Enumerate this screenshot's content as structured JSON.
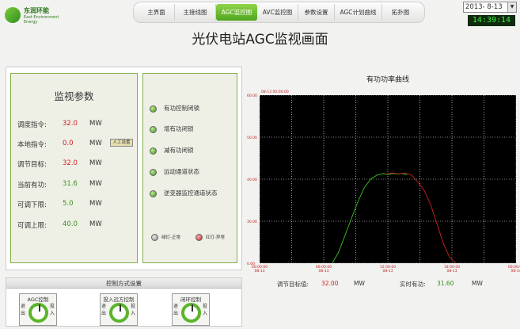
{
  "logo": {
    "name_cn": "东润环能",
    "name_en_1": "East Environment",
    "name_en_2": "Energy"
  },
  "nav": {
    "tabs": [
      {
        "label": "主界面",
        "active": false
      },
      {
        "label": "主接线图",
        "active": false
      },
      {
        "label": "AGC监控图",
        "active": true
      },
      {
        "label": "AVC监控图",
        "active": false
      },
      {
        "label": "参数设置",
        "active": false
      },
      {
        "label": "AGC计划曲线",
        "active": false
      },
      {
        "label": "拓扑图",
        "active": false
      }
    ]
  },
  "date": {
    "value": "2013- 8-13"
  },
  "clock": {
    "value": "14:39:14"
  },
  "page_title": "光伏电站AGC监视画面",
  "params": {
    "title": "监视参数",
    "rows": [
      {
        "label": "调度指令:",
        "value": "32.0",
        "unit": "MW"
      },
      {
        "label": "本地指令:",
        "value": "0.0",
        "unit": "MW",
        "button": "人工设置"
      },
      {
        "label": "调节目标:",
        "value": "32.0",
        "unit": "MW"
      },
      {
        "label": "当前有功:",
        "value": "31.6",
        "unit": "MW"
      },
      {
        "label": "可调下限:",
        "value": "5.0",
        "unit": "MW"
      },
      {
        "label": "可调上限:",
        "value": "40.0",
        "unit": "MW"
      }
    ]
  },
  "status": {
    "items": [
      {
        "label": "有功控制闭锁",
        "state": "green"
      },
      {
        "label": "增有功闭锁",
        "state": "green"
      },
      {
        "label": "减有功闭锁",
        "state": "green"
      },
      {
        "label": "远动通道状态",
        "state": "green"
      },
      {
        "label": "逆变器监控通道状态",
        "state": "green"
      }
    ],
    "legend": [
      {
        "label": "绿灯-正常",
        "state": "gray"
      },
      {
        "label": "红灯-异常",
        "state": "red"
      }
    ]
  },
  "control": {
    "title": "控制方式设置",
    "items": [
      {
        "label": "AGC控制",
        "off": "退出",
        "on": "投入"
      },
      {
        "label": "投入远方控制",
        "off": "退出",
        "on": "投入"
      },
      {
        "label": "闭环控制",
        "off": "退出",
        "on": "投入"
      }
    ]
  },
  "chart_data": {
    "type": "line",
    "title": "有功功率曲线",
    "top_time": "08-13 00:00:00",
    "y_tick_labels": [
      "60.00",
      "50.00",
      "40.00",
      "30.00",
      "0.00"
    ],
    "x_tick_labels": [
      "00:00:00\n08-13",
      "06:00:00\n08-13",
      "12:00:00\n08-13",
      "18:00:00\n08-13",
      "00:00:00\n08-14"
    ],
    "ylim": [
      0,
      60
    ],
    "x_hours_range": [
      0,
      24
    ],
    "grid": true,
    "series": [
      {
        "color": "#38c020",
        "points": [
          [
            6.8,
            0
          ],
          [
            7.4,
            4
          ],
          [
            8.0,
            10
          ],
          [
            8.6,
            16
          ],
          [
            9.2,
            22
          ],
          [
            9.8,
            27
          ],
          [
            10.4,
            30
          ],
          [
            11.0,
            31.5
          ],
          [
            11.6,
            32
          ],
          [
            12.0,
            31.6
          ],
          [
            12.4,
            32
          ],
          [
            13.0,
            31.8
          ],
          [
            13.4,
            32
          ],
          [
            13.8,
            31.5
          ]
        ]
      },
      {
        "color": "#d02020",
        "points": [
          [
            11.8,
            31.8
          ],
          [
            12.4,
            32.2
          ],
          [
            13.0,
            31.9
          ],
          [
            13.6,
            32.2
          ],
          [
            14.2,
            31.5
          ],
          [
            14.8,
            29
          ],
          [
            15.4,
            26
          ],
          [
            16.0,
            21
          ],
          [
            16.6,
            14
          ],
          [
            17.2,
            7
          ],
          [
            17.8,
            2
          ],
          [
            18.4,
            0
          ]
        ]
      }
    ]
  },
  "footer": {
    "target_label": "调节目标值:",
    "target_value": "32.00",
    "target_unit": "MW",
    "actual_label": "实时有功:",
    "actual_value": "31.60",
    "actual_unit": "MW"
  },
  "colors": {
    "accent_green": "#5bb52a",
    "value_red": "#d02020",
    "chart_bg": "#000000"
  }
}
